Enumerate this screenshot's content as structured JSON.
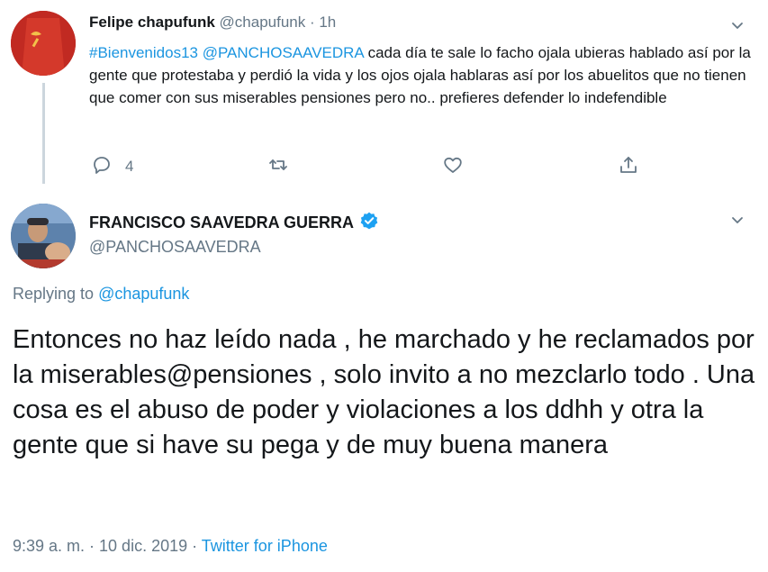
{
  "tweet1": {
    "display_name": "Felipe chapufunk",
    "handle": "@chapufunk",
    "time": " · 1h",
    "hashtag": "#Bienvenidos13",
    "mention": "@PANCHOSAAVEDRA",
    "text_rest": " cada día te sale lo facho ojala ubieras hablado así por la gente que protestaba y perdió la vida y los ojos ojala hablaras así por los abuelitos que no tienen que comer con sus miserables pensiones pero no.. prefieres defender lo indefendible",
    "reply_count": "4"
  },
  "tweet2": {
    "display_name": "FRANCISCO SAAVEDRA GUERRA",
    "handle": "@PANCHOSAAVEDRA",
    "replying_prefix": "Replying to ",
    "replying_handle": "@chapufunk",
    "text": "Entonces no haz leído nada , he marchado y he reclamados por la miserables@pensiones , solo invito a no mezclarlo todo . Una cosa es el abuso de poder y violaciones a los ddhh y otra la gente que si have su pega y de muy buena manera",
    "timestamp": "9:39 a. m. · 10 dic. 2019 · ",
    "source": "Twitter for iPhone"
  },
  "colors": {
    "link": "#1b95e0",
    "secondary": "#657786",
    "verified": "#1da1f2"
  },
  "icons": [
    "chevron-down-icon",
    "reply-icon",
    "retweet-icon",
    "like-icon",
    "share-icon",
    "verified-badge-icon"
  ]
}
